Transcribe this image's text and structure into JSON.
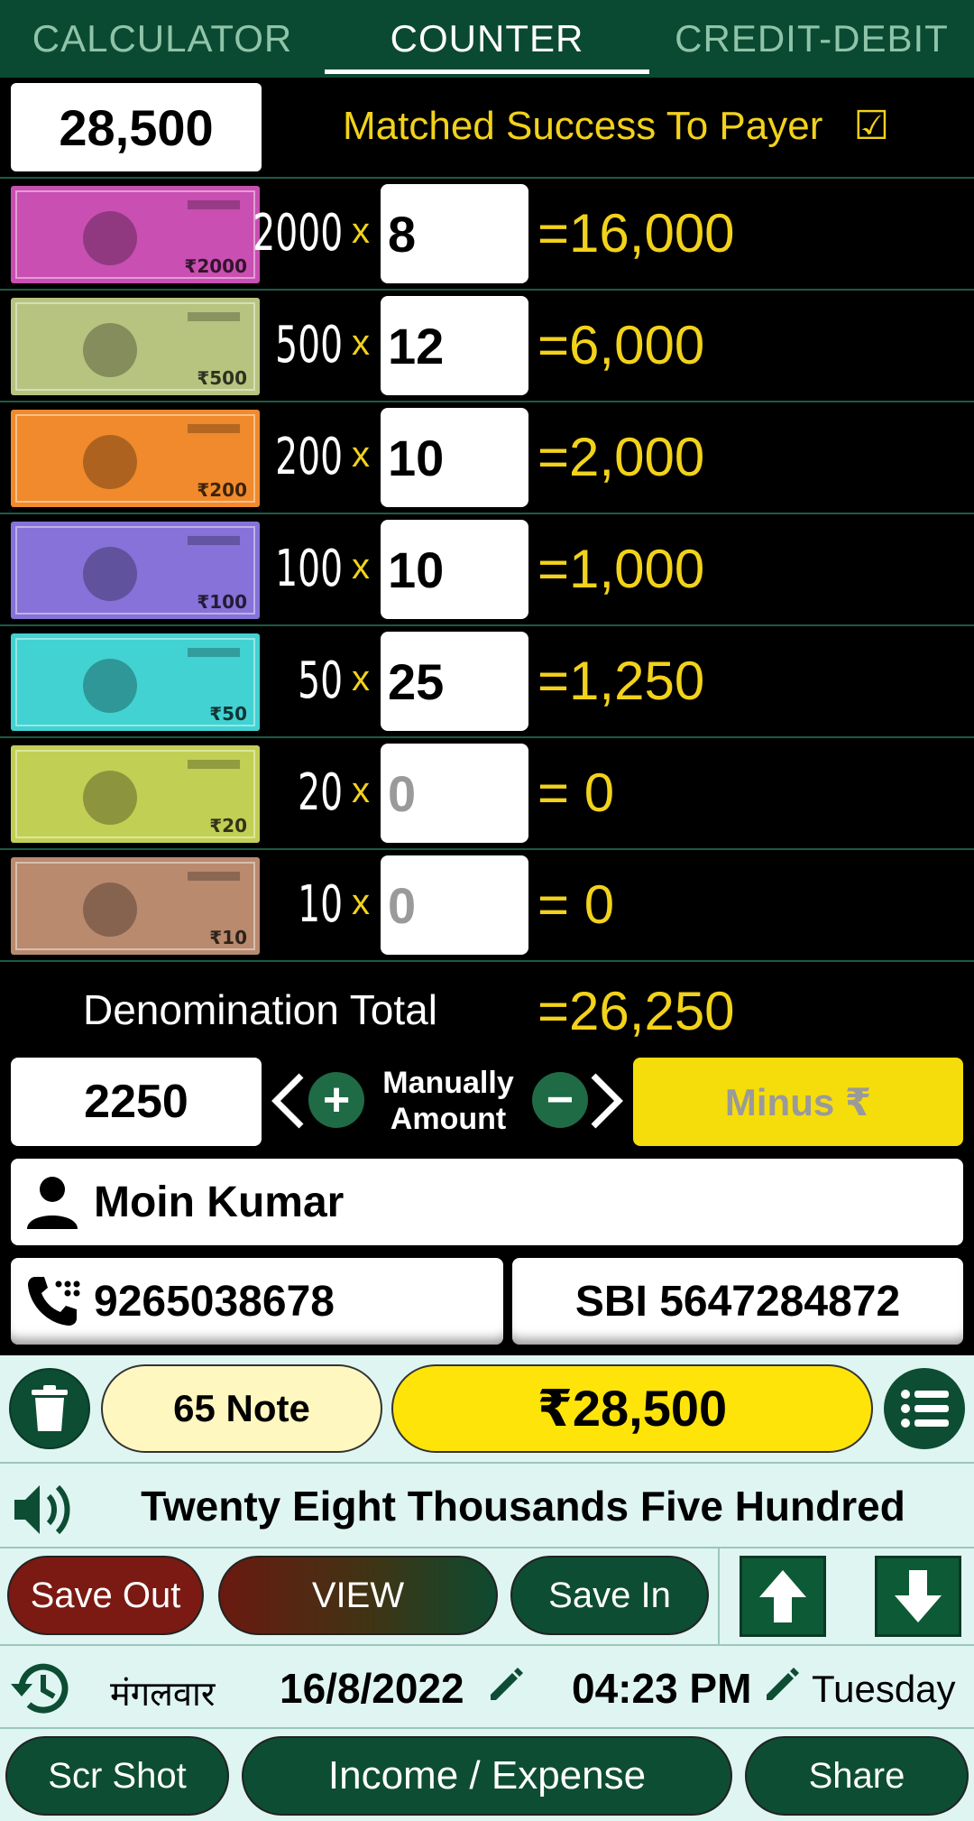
{
  "tabs": [
    {
      "label": "CALCULATOR"
    },
    {
      "label": "COUNTER"
    },
    {
      "label": "CREDIT-DEBIT"
    }
  ],
  "active_tab": "COUNTER",
  "summary": {
    "amount": "28,500",
    "matched_text": "Matched Success To Payer",
    "matched_checkbox": "☑"
  },
  "denominations": [
    {
      "value": "2000",
      "times": "x",
      "qty": "8",
      "result": "=16,000",
      "note_color": "#c94fb2",
      "note_text": "₹2000"
    },
    {
      "value": "500",
      "times": "x",
      "qty": "12",
      "result": "=6,000",
      "note_color": "#b7c47f",
      "note_text": "₹500"
    },
    {
      "value": "200",
      "times": "x",
      "qty": "10",
      "result": "=2,000",
      "note_color": "#f08a2c",
      "note_text": "₹200"
    },
    {
      "value": "100",
      "times": "x",
      "qty": "10",
      "result": "=1,000",
      "note_color": "#8672d8",
      "note_text": "₹100"
    },
    {
      "value": "50",
      "times": "x",
      "qty": "25",
      "result": "=1,250",
      "note_color": "#42d2d2",
      "note_text": "₹50"
    },
    {
      "value": "20",
      "times": "x",
      "qty": "0",
      "result": "= 0",
      "note_color": "#c2cf55",
      "note_text": "₹20"
    },
    {
      "value": "10",
      "times": "x",
      "qty": "0",
      "result": "= 0",
      "note_color": "#b98a6e",
      "note_text": "₹10"
    }
  ],
  "denomination_total": {
    "label": "Denomination Total",
    "value": "=26,250"
  },
  "manual": {
    "amount": "2250",
    "label_line1": "Manually",
    "label_line2": "Amount",
    "plus_icon": "+",
    "minus_icon": "−",
    "minus_button": "Minus ₹"
  },
  "customer": {
    "name": "Moin Kumar",
    "phone": "9265038678",
    "bank": "SBI 5647284872"
  },
  "footer": {
    "note_count": "65 Note",
    "grand_total": "₹28,500",
    "words": "Twenty Eight Thousands Five Hundred",
    "save_out": "Save Out",
    "view": "VIEW",
    "save_in": "Save In",
    "day_hindi": "मंगलवार",
    "date": "16/8/2022",
    "time": "04:23 PM",
    "day_english": "Tuesday",
    "scr_shot": "Scr Shot",
    "income_expense": "Income / Expense",
    "share": "Share"
  },
  "colors": {
    "header_green": "#0b4a32",
    "accent_yellow": "#f2d21b",
    "panel_bg": "#dff5f1",
    "button_green": "#0d4d33",
    "button_red": "#7a1a12"
  }
}
